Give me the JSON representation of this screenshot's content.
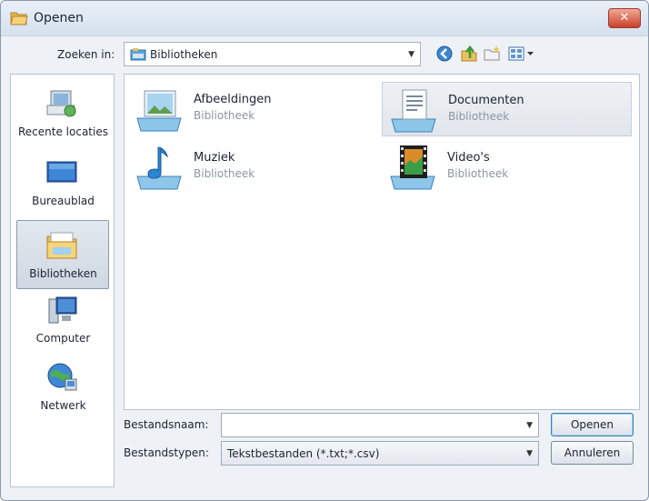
{
  "window": {
    "title": "Openen",
    "close_glyph": "✕"
  },
  "lookin": {
    "label": "Zoeken in:",
    "value": "Bibliotheken"
  },
  "toolbar": {
    "icons": [
      "back-icon",
      "up-folder-icon",
      "new-folder-icon",
      "view-menu-icon"
    ],
    "arrow_glyph": "▼"
  },
  "sidebar": {
    "items": [
      {
        "label": "Recente locaties",
        "icon": "recent-places-icon"
      },
      {
        "label": "Bureaublad",
        "icon": "desktop-icon"
      },
      {
        "label": "Bibliotheken",
        "icon": "libraries-icon",
        "selected": true
      },
      {
        "label": "Computer",
        "icon": "computer-icon"
      },
      {
        "label": "Netwerk",
        "icon": "network-icon"
      }
    ]
  },
  "libraries": [
    {
      "name": "Afbeeldingen",
      "type": "Bibliotheek",
      "icon": "pictures-library-icon"
    },
    {
      "name": "Documenten",
      "type": "Bibliotheek",
      "icon": "documents-library-icon",
      "selected": true
    },
    {
      "name": "Muziek",
      "type": "Bibliotheek",
      "icon": "music-library-icon"
    },
    {
      "name": "Video's",
      "type": "Bibliotheek",
      "icon": "videos-library-icon"
    }
  ],
  "filename": {
    "label": "Bestandsnaam:",
    "value": ""
  },
  "filetype": {
    "label": "Bestandstypen:",
    "value": "Tekstbestanden (*.txt;*.csv)"
  },
  "buttons": {
    "open": "Openen",
    "cancel": "Annuleren"
  },
  "colors": {
    "accent": "#3c7fb1",
    "close": "#c9412c",
    "selection": "#e1e6ec"
  }
}
